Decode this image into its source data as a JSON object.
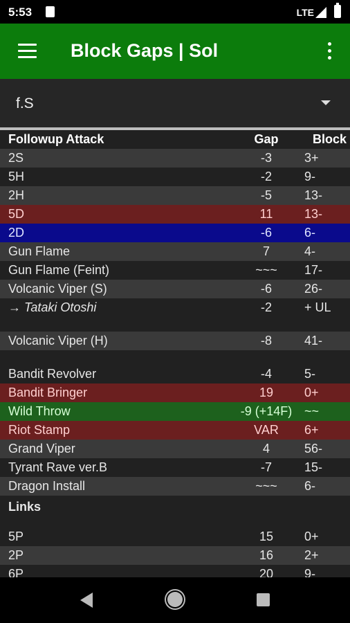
{
  "status_bar": {
    "time": "5:53",
    "network": "LTE"
  },
  "app_bar": {
    "title": "Block Gaps | Sol"
  },
  "selector": {
    "value": "f.S"
  },
  "table": {
    "headers": {
      "attack": "Followup Attack",
      "gap": "Gap",
      "block": "Block"
    },
    "rows": [
      {
        "attack": "2S",
        "gap": "-3",
        "block": "+3"
      },
      {
        "attack": "5H",
        "gap": "-2",
        "block": "-9"
      },
      {
        "attack": "2H",
        "gap": "-5",
        "block": "-13"
      },
      {
        "attack": "5D",
        "gap": "11",
        "block": "-13"
      },
      {
        "attack": "2D",
        "gap": "-6",
        "block": "-6"
      },
      {
        "attack": "Gun Flame",
        "gap": "7",
        "block": "-4"
      },
      {
        "attack": "Gun Flame (Feint)",
        "gap": "~~~",
        "block": "-17"
      },
      {
        "attack": "Volcanic Viper (S)",
        "gap": "-6",
        "block": "-26"
      },
      {
        "attack": "→ Tataki Otoshi",
        "gap": "-2",
        "block": "UL +"
      },
      {
        "attack": "Volcanic Viper (H)",
        "gap": "-8",
        "block": "-41"
      },
      {
        "attack": "Bandit Revolver",
        "gap": "-4",
        "block": "-5"
      },
      {
        "attack": "Bandit Bringer",
        "gap": "19",
        "block": "+0"
      },
      {
        "attack": "Wild Throw",
        "gap": "-9 (+14F)",
        "block": "~~"
      },
      {
        "attack": "Riot Stamp",
        "gap": "VAR",
        "block": "+6"
      },
      {
        "attack": "Grand Viper",
        "gap": "4",
        "block": "-56"
      },
      {
        "attack": "Tyrant Rave ver.B",
        "gap": "-7",
        "block": "-15"
      },
      {
        "attack": "Dragon Install",
        "gap": "~~~",
        "block": "-6"
      }
    ],
    "links_label": "Links",
    "links": [
      {
        "attack": "5P",
        "gap": "15",
        "block": "+0"
      },
      {
        "attack": "2P",
        "gap": "16",
        "block": "+2"
      },
      {
        "attack": "6P",
        "gap": "20",
        "block": "-9"
      }
    ]
  }
}
